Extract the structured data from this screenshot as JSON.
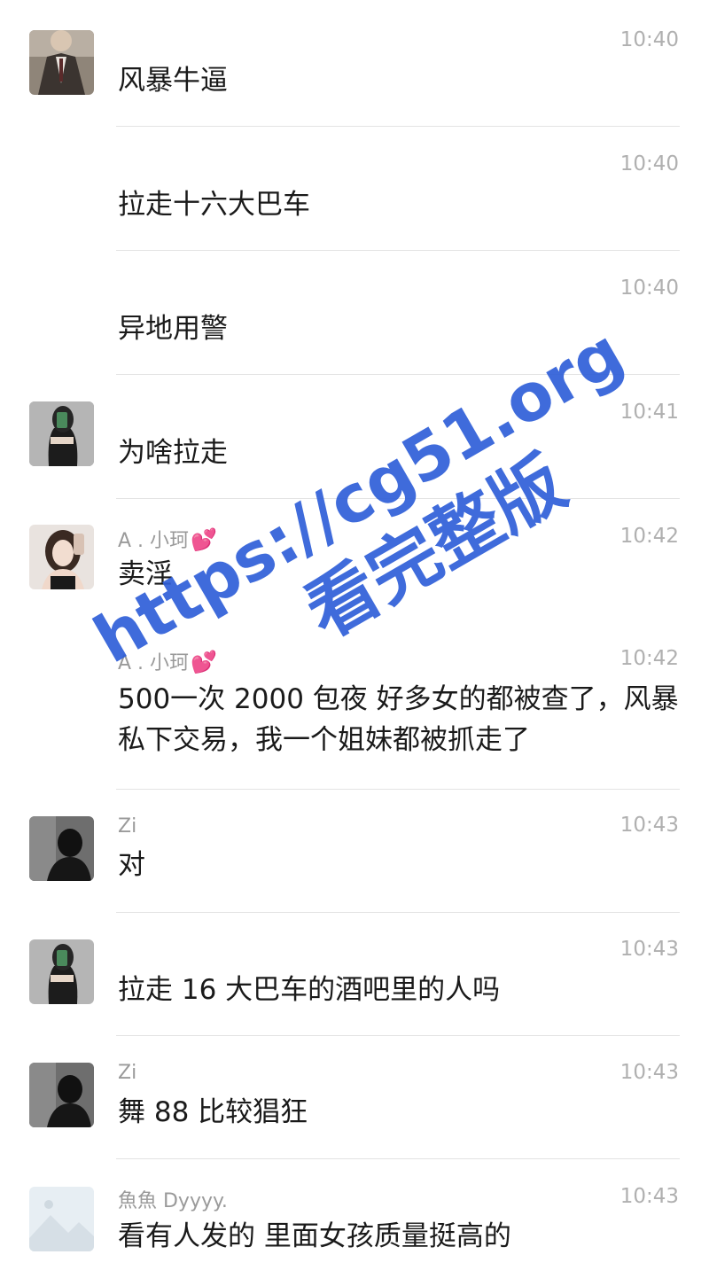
{
  "messages": [
    {
      "avatar": "avatar-man-suit",
      "sender": "",
      "heart": false,
      "time": "10:40",
      "text": "风暴牛逼"
    },
    {
      "avatar": "",
      "sender": "",
      "heart": false,
      "time": "10:40",
      "text": "拉走十六大巴车"
    },
    {
      "avatar": "",
      "sender": "",
      "heart": false,
      "time": "10:40",
      "text": "异地用警"
    },
    {
      "avatar": "avatar-woman-phone",
      "sender": "",
      "heart": false,
      "time": "10:41",
      "text": "为啥拉走"
    },
    {
      "avatar": "avatar-woman-selfie",
      "sender": "A . 小珂",
      "heart": true,
      "time": "10:42",
      "text": "卖淫"
    },
    {
      "avatar": "",
      "sender": "A . 小珂",
      "heart": true,
      "time": "10:42",
      "text": "500一次 2000 包夜 好多女的都被查了，风暴私下交易，我一个姐妹都被抓走了"
    },
    {
      "avatar": "avatar-dark-man",
      "sender": "Zi",
      "heart": false,
      "time": "10:43",
      "text": "对"
    },
    {
      "avatar": "avatar-woman-phone",
      "sender": "",
      "heart": false,
      "time": "10:43",
      "text": "拉走 16 大巴车的酒吧里的人吗"
    },
    {
      "avatar": "avatar-dark-man",
      "sender": "Zi",
      "heart": false,
      "time": "10:43",
      "text": "舞 88 比较猖狂"
    },
    {
      "avatar": "avatar-landscape",
      "sender": "魚魚 Dyyyy.",
      "heart": false,
      "time": "10:43",
      "text": "看有人发的 里面女孩质量挺高的"
    }
  ],
  "watermark": {
    "url": "https://cg51.org",
    "sub": "看完整版",
    "color": "#2f5fd8"
  },
  "colors": {
    "time": "#b0b0b0",
    "sender": "#9a9a9a",
    "text": "#1a1a1a",
    "divider": "#e3e3e3"
  }
}
